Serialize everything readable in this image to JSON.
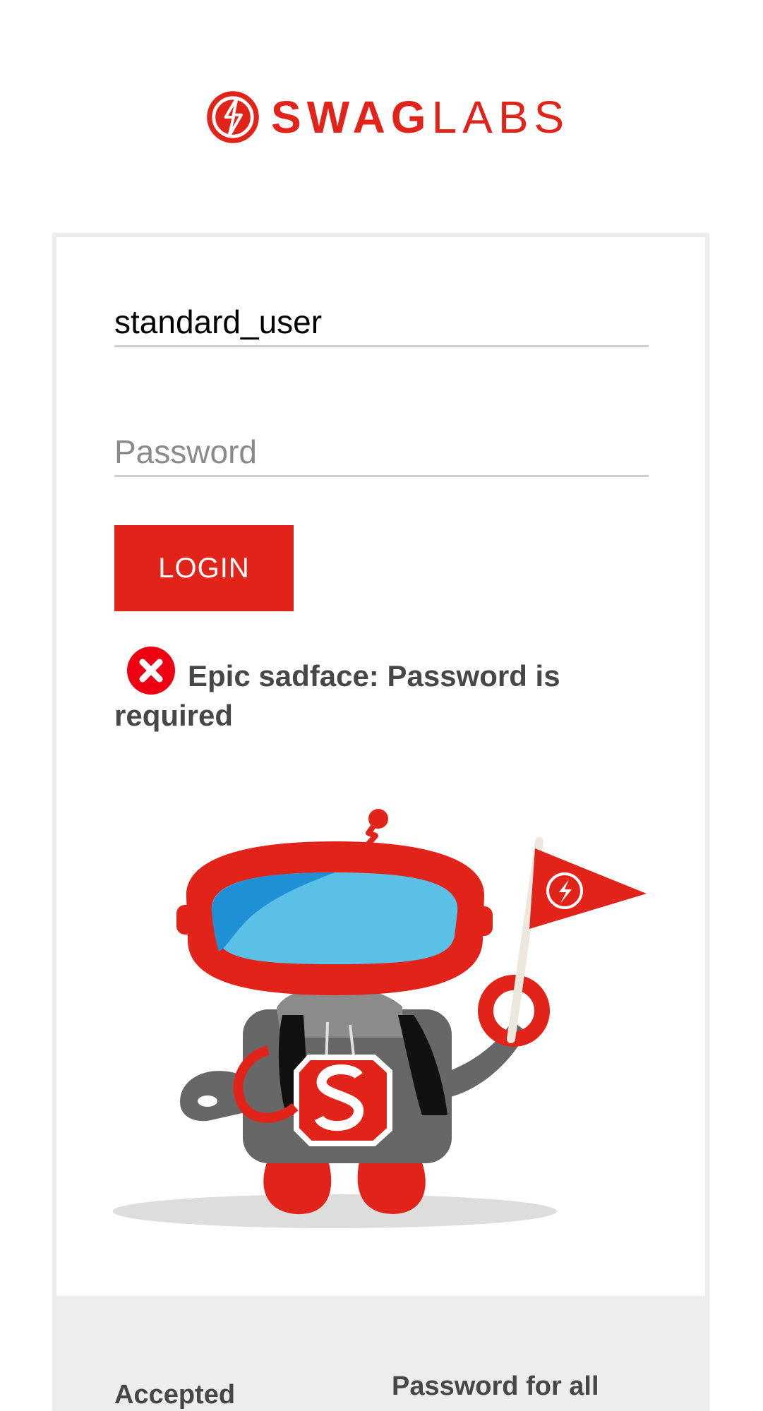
{
  "logo": {
    "brand_bold": "SWAG",
    "brand_light": "LABS"
  },
  "login_form": {
    "username_value": "standard_user",
    "password_placeholder": "Password",
    "login_button_label": "LOGIN"
  },
  "error": {
    "message": "Epic sadface: Password is required"
  },
  "footer": {
    "left_title": "Accepted",
    "right_title": "Password for all"
  },
  "colors": {
    "accent": "#e2231a",
    "text_dark": "#474747",
    "placeholder": "#8a8a8a",
    "divider": "#cfcfcf",
    "footer_band": "#ededed"
  },
  "icons": {
    "brand_logo": "swaglabs-bolt-icon",
    "error": "error-x-circle-icon",
    "illustration": "robot-mascot-illustration"
  }
}
